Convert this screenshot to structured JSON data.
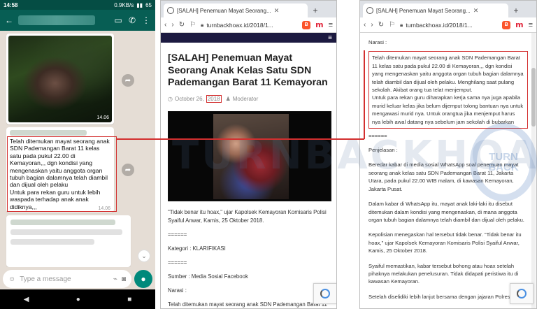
{
  "phone": {
    "status": {
      "time": "14:58",
      "speed": "0.9KB/s",
      "battery": "65"
    },
    "message1": {
      "time": "14.06"
    },
    "message2": {
      "text": "Telah ditemukan mayat seorang anak SDN Pademangan Barat 11 kelas satu pada pukul 22.00 di Kemayoran,,, dgn kondisi yang mengenaskan yaitu anggota organ tubuh bagian dalamnya telah diambil dan dijual oleh pelaku\nUntuk para rekan guru untuk lebih waspada terhadap anak anak didiknya,,,",
      "time": "14.06"
    },
    "composer": {
      "placeholder": "Type a message"
    }
  },
  "middle_browser": {
    "tab_title": "[SALAH] Penemuan Mayat Seorang...",
    "url": "turnbackhoax.id/2018/1...",
    "article": {
      "title": "[SALAH] Penemuan Mayat Seorang Anak Kelas Satu SDN Pademangan Barat 11 Kemayoran",
      "date_prefix": "October 26, ",
      "date_year": "2018",
      "author": "Moderator"
    },
    "paragraphs": {
      "quote": "\"Tidak benar itu hoax,\" ujar Kapolsek Kemayoran Komisaris Polisi Syaiful Anwar, Kamis, 25 Oktober 2018.",
      "sep1": "======",
      "kategori": "Kategori : KLARIFIKASI",
      "sep2": "======",
      "sumber": "Sumber : Media Sosial Facebook",
      "narasi_label": "Narasi :",
      "narasi_start": "Telah ditemukan mayat seorang anak SDN Pademangan Barat 11"
    }
  },
  "right_browser": {
    "tab_title": "[SALAH] Penemuan Mayat Seorang...",
    "url": "turnbackhoax.id/2018/1...",
    "narasi_label": "Narasi :",
    "narasi_text": "Telah ditemukan mayat seorang anak SDN Pademangan Barat 11 kelas satu pada pukul 22.00 di Kemayoran,,, dgn kondisi yang mengenaskan yaitu anggota organ tubuh bagian dalamnya telah diambil dan dijual oleh pelaku. Menghilang saat pulang sekolah. Akibat orang tua telat menjemput.\nUntuk para rekan guru diharapkan kerja sama nya juga apabila murid keluar kelas jika belum dijemput tolong bantuan nya untuk mengawasi murid nya. Untuk orangtua jika menjemput harus nya lebih awal datang nya sebelum jam sekolah di bubarkan",
    "sep": "======",
    "penjelasan_label": "Penjelasan :",
    "p1": "Beredar kabar di media sosial WhatsApp soal penemuan mayat seorang anak kelas satu SDN Pademangan Barat 11, Jakarta Utara, pada pukul 22.00 WIB malam, di kawasan Kemayoran, Jakarta Pusat.",
    "p2": "Dalam kabar di WhatsApp itu, mayat anak laki-laki itu disebut ditemukan dalam kondisi yang mengenaskan, di mana anggota organ tubuh bagian dalamnya telah diambil dan dijual oleh pelaku.",
    "p3": "Kepolisian menegaskan hal tersebut tidak benar. \"Tidak benar itu hoax,\" ujar Kapolsek Kemayoran Komisaris Polisi Syaiful Anwar, Kamis, 25 Oktober 2018.",
    "p4": "Syaiful memastikan, kabar tersebut bohong atau hoax setelah pihaknya melakukan penelusuran. Tidak didapati peristiwa itu di kawasan Kemayoran.",
    "p5": "Setelah diselidiki lebih lanjut bersama dengan jajaran Polres"
  },
  "watermark": {
    "text": "TURNBACKHOAX",
    "seal": "TURN BACK"
  },
  "colors": {
    "highlight": "#d32f2f",
    "whatsapp": "#075e54",
    "fab": "#00897b"
  }
}
